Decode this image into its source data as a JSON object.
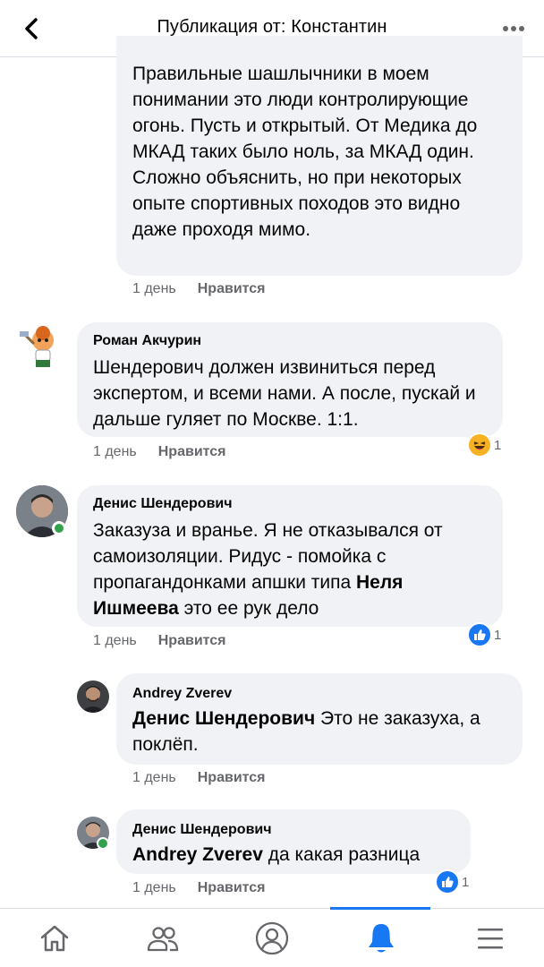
{
  "header": {
    "title": "Публикация от: Константин",
    "back_icon": "chevron-left-icon",
    "more_icon": "more-dots-icon"
  },
  "comments": [
    {
      "text": "Правильные шашлычники в моем понимании это люди контролирующие огонь. Пусть и открытый. От Медика до МКАД таких было ноль, за МКАД один. Сложно объяснить, но при некоторых опыте спортивных походов это видно даже проходя мимо.",
      "time": "1 день",
      "like": "Нравится"
    },
    {
      "author": "Роман Акчурин",
      "text": "Шендерович должен извиниться перед экспертом, и всеми нами. А после, пускай и  дальше гуляет по Москве. 1:1.",
      "time": "1 день",
      "like": "Нравится",
      "reaction_icon": "haha-icon",
      "reaction_count": "1"
    },
    {
      "author": "Денис Шендерович",
      "text_before": "Заказуза и вранье. Я не отказывался от самоизоляции. Ридус - помойка с пропагандонками апшки типа ",
      "mention": "Неля Ишмеева",
      "text_after": " это ее рук дело",
      "time": "1 день",
      "like": "Нравится",
      "reaction_icon": "like-icon",
      "reaction_count": "1"
    },
    {
      "author": "Andrey Zverev",
      "mention": "Денис Шендерович",
      "text_after": " Это не заказуха, а поклёп.",
      "time": "1 день",
      "like": "Нравится"
    },
    {
      "author": "Денис Шендерович",
      "mention": "Andrey Zverev",
      "text_after": " да какая разница",
      "time": "1 день",
      "like": "Нравится",
      "reaction_icon": "like-icon",
      "reaction_count": "1"
    }
  ],
  "tabbar": {
    "tabs": [
      "home-icon",
      "friends-icon",
      "profile-icon",
      "notifications-bell-icon",
      "menu-icon"
    ],
    "active_color": "#1877f2",
    "inactive_color": "#65676b"
  },
  "colors": {
    "bubble": "#f0f2f5",
    "online": "#31a24c",
    "like_blue": "#1877f2",
    "haha_yellow": "#f7b125"
  }
}
